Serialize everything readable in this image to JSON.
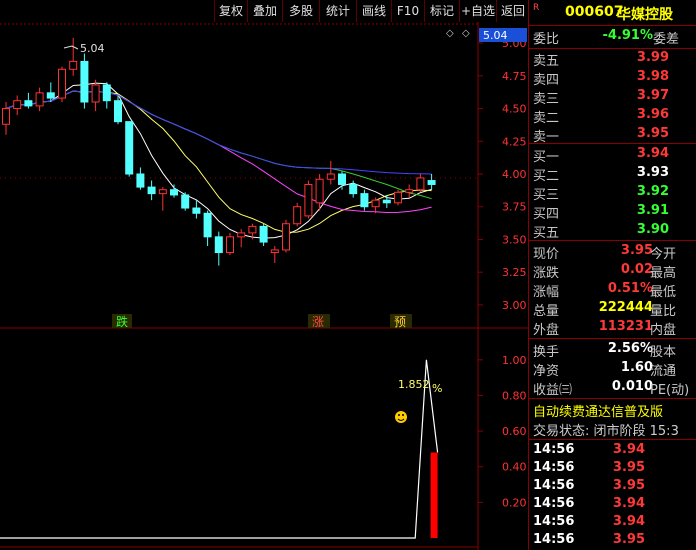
{
  "toolbar": {
    "buttons": [
      "复权",
      "叠加",
      "多股",
      "统计",
      "画线",
      "F10",
      "标记",
      "+自选",
      "返回"
    ]
  },
  "main_chart": {
    "price_axis": [
      "5.00",
      "4.75",
      "4.50",
      "4.25",
      "4.00",
      "3.75",
      "3.50",
      "3.25",
      "3.00"
    ],
    "current_price_tag": "5.04",
    "high_label": "5.04",
    "markers": [
      "跌",
      "涨",
      "预"
    ]
  },
  "sub_chart": {
    "axis": [
      "1.00",
      "0.80",
      "0.60",
      "0.40",
      "0.20"
    ],
    "value_label": "1.852",
    "unit": "%"
  },
  "colors": {
    "up": "#ff3232",
    "down": "#54ffff",
    "ma5": "#ffffff",
    "ma10": "#ffff66",
    "ma20": "#ff44ff",
    "ma30": "#33cc33",
    "ma60": "#4444ff"
  },
  "chart_data": {
    "type": "candlestick",
    "ylim": [
      2.9,
      5.1
    ],
    "candles": [
      [
        4.38,
        4.55,
        4.3,
        4.5
      ],
      [
        4.5,
        4.6,
        4.45,
        4.56
      ],
      [
        4.56,
        4.62,
        4.5,
        4.52
      ],
      [
        4.52,
        4.66,
        4.48,
        4.62
      ],
      [
        4.62,
        4.7,
        4.55,
        4.58
      ],
      [
        4.58,
        4.82,
        4.55,
        4.8
      ],
      [
        4.8,
        5.04,
        4.75,
        4.86
      ],
      [
        4.86,
        4.92,
        4.5,
        4.55
      ],
      [
        4.55,
        4.72,
        4.48,
        4.68
      ],
      [
        4.68,
        4.7,
        4.5,
        4.56
      ],
      [
        4.56,
        4.6,
        4.38,
        4.4
      ],
      [
        4.4,
        4.4,
        3.98,
        4.0
      ],
      [
        4.0,
        4.05,
        3.88,
        3.9
      ],
      [
        3.9,
        3.95,
        3.8,
        3.85
      ],
      [
        3.85,
        3.9,
        3.72,
        3.88
      ],
      [
        3.88,
        3.92,
        3.82,
        3.84
      ],
      [
        3.84,
        3.86,
        3.72,
        3.74
      ],
      [
        3.74,
        3.8,
        3.66,
        3.7
      ],
      [
        3.7,
        3.72,
        3.45,
        3.52
      ],
      [
        3.52,
        3.56,
        3.3,
        3.4
      ],
      [
        3.4,
        3.55,
        3.38,
        3.52
      ],
      [
        3.52,
        3.58,
        3.44,
        3.55
      ],
      [
        3.55,
        3.62,
        3.5,
        3.6
      ],
      [
        3.6,
        3.62,
        3.45,
        3.48
      ],
      [
        3.4,
        3.45,
        3.32,
        3.42
      ],
      [
        3.42,
        3.65,
        3.4,
        3.62
      ],
      [
        3.62,
        3.78,
        3.6,
        3.75
      ],
      [
        3.68,
        3.95,
        3.66,
        3.92
      ],
      [
        3.78,
        4.0,
        3.72,
        3.96
      ],
      [
        3.96,
        4.1,
        3.92,
        4.0
      ],
      [
        4.0,
        4.02,
        3.88,
        3.92
      ],
      [
        3.92,
        3.95,
        3.82,
        3.85
      ],
      [
        3.85,
        3.88,
        3.72,
        3.75
      ],
      [
        3.75,
        3.82,
        3.7,
        3.8
      ],
      [
        3.8,
        3.84,
        3.74,
        3.78
      ],
      [
        3.78,
        3.88,
        3.76,
        3.86
      ],
      [
        3.86,
        3.92,
        3.82,
        3.88
      ],
      [
        3.88,
        4.0,
        3.86,
        3.97
      ],
      [
        3.95,
        4.0,
        3.88,
        3.92
      ]
    ],
    "sub_series": [
      0,
      0,
      0,
      0,
      0,
      0,
      0,
      0,
      0,
      0,
      0,
      0,
      0,
      0,
      0,
      0,
      0,
      0,
      0,
      0,
      0,
      0,
      0,
      0,
      0,
      0,
      0,
      0,
      0,
      0,
      0,
      0,
      0,
      0,
      0,
      0,
      0,
      1.0,
      0.48
    ]
  },
  "quote": {
    "code": "000607",
    "name": "华媒控股",
    "wei_bi_label": "委比",
    "wei_bi": "-4.91%",
    "wei_cha_label": "委差",
    "sell": [
      {
        "label": "卖五",
        "price": "3.99"
      },
      {
        "label": "卖四",
        "price": "3.98"
      },
      {
        "label": "卖三",
        "price": "3.97"
      },
      {
        "label": "卖二",
        "price": "3.96"
      },
      {
        "label": "卖一",
        "price": "3.95"
      }
    ],
    "buy": [
      {
        "label": "买一",
        "price": "3.94"
      },
      {
        "label": "买二",
        "price": "3.93"
      },
      {
        "label": "买三",
        "price": "3.92"
      },
      {
        "label": "买四",
        "price": "3.91"
      },
      {
        "label": "买五",
        "price": "3.90"
      }
    ],
    "stats": [
      {
        "label": "现价",
        "value": "3.95",
        "label2": "今开"
      },
      {
        "label": "涨跌",
        "value": "0.02",
        "label2": "最高"
      },
      {
        "label": "涨幅",
        "value": "0.51%",
        "label2": "最低"
      },
      {
        "label": "总量",
        "value": "222444",
        "label2": "量比"
      },
      {
        "label": "外盘",
        "value": "113231",
        "label2": "内盘"
      }
    ],
    "stats2": [
      {
        "label": "换手",
        "value": "2.56%",
        "label2": "股本"
      },
      {
        "label": "净资",
        "value": "1.60",
        "label2": "流通"
      },
      {
        "label": "收益㈢",
        "value": "0.010",
        "label2": "PE(动)"
      }
    ],
    "banner": "自动续费通达信普及版",
    "status": "交易状态: 闭市阶段 15:3",
    "ticks": [
      {
        "time": "14:56",
        "price": "3.94"
      },
      {
        "time": "14:56",
        "price": "3.95"
      },
      {
        "time": "14:56",
        "price": "3.95"
      },
      {
        "time": "14:56",
        "price": "3.94"
      },
      {
        "time": "14:56",
        "price": "3.94"
      },
      {
        "time": "14:56",
        "price": "3.95"
      }
    ]
  }
}
